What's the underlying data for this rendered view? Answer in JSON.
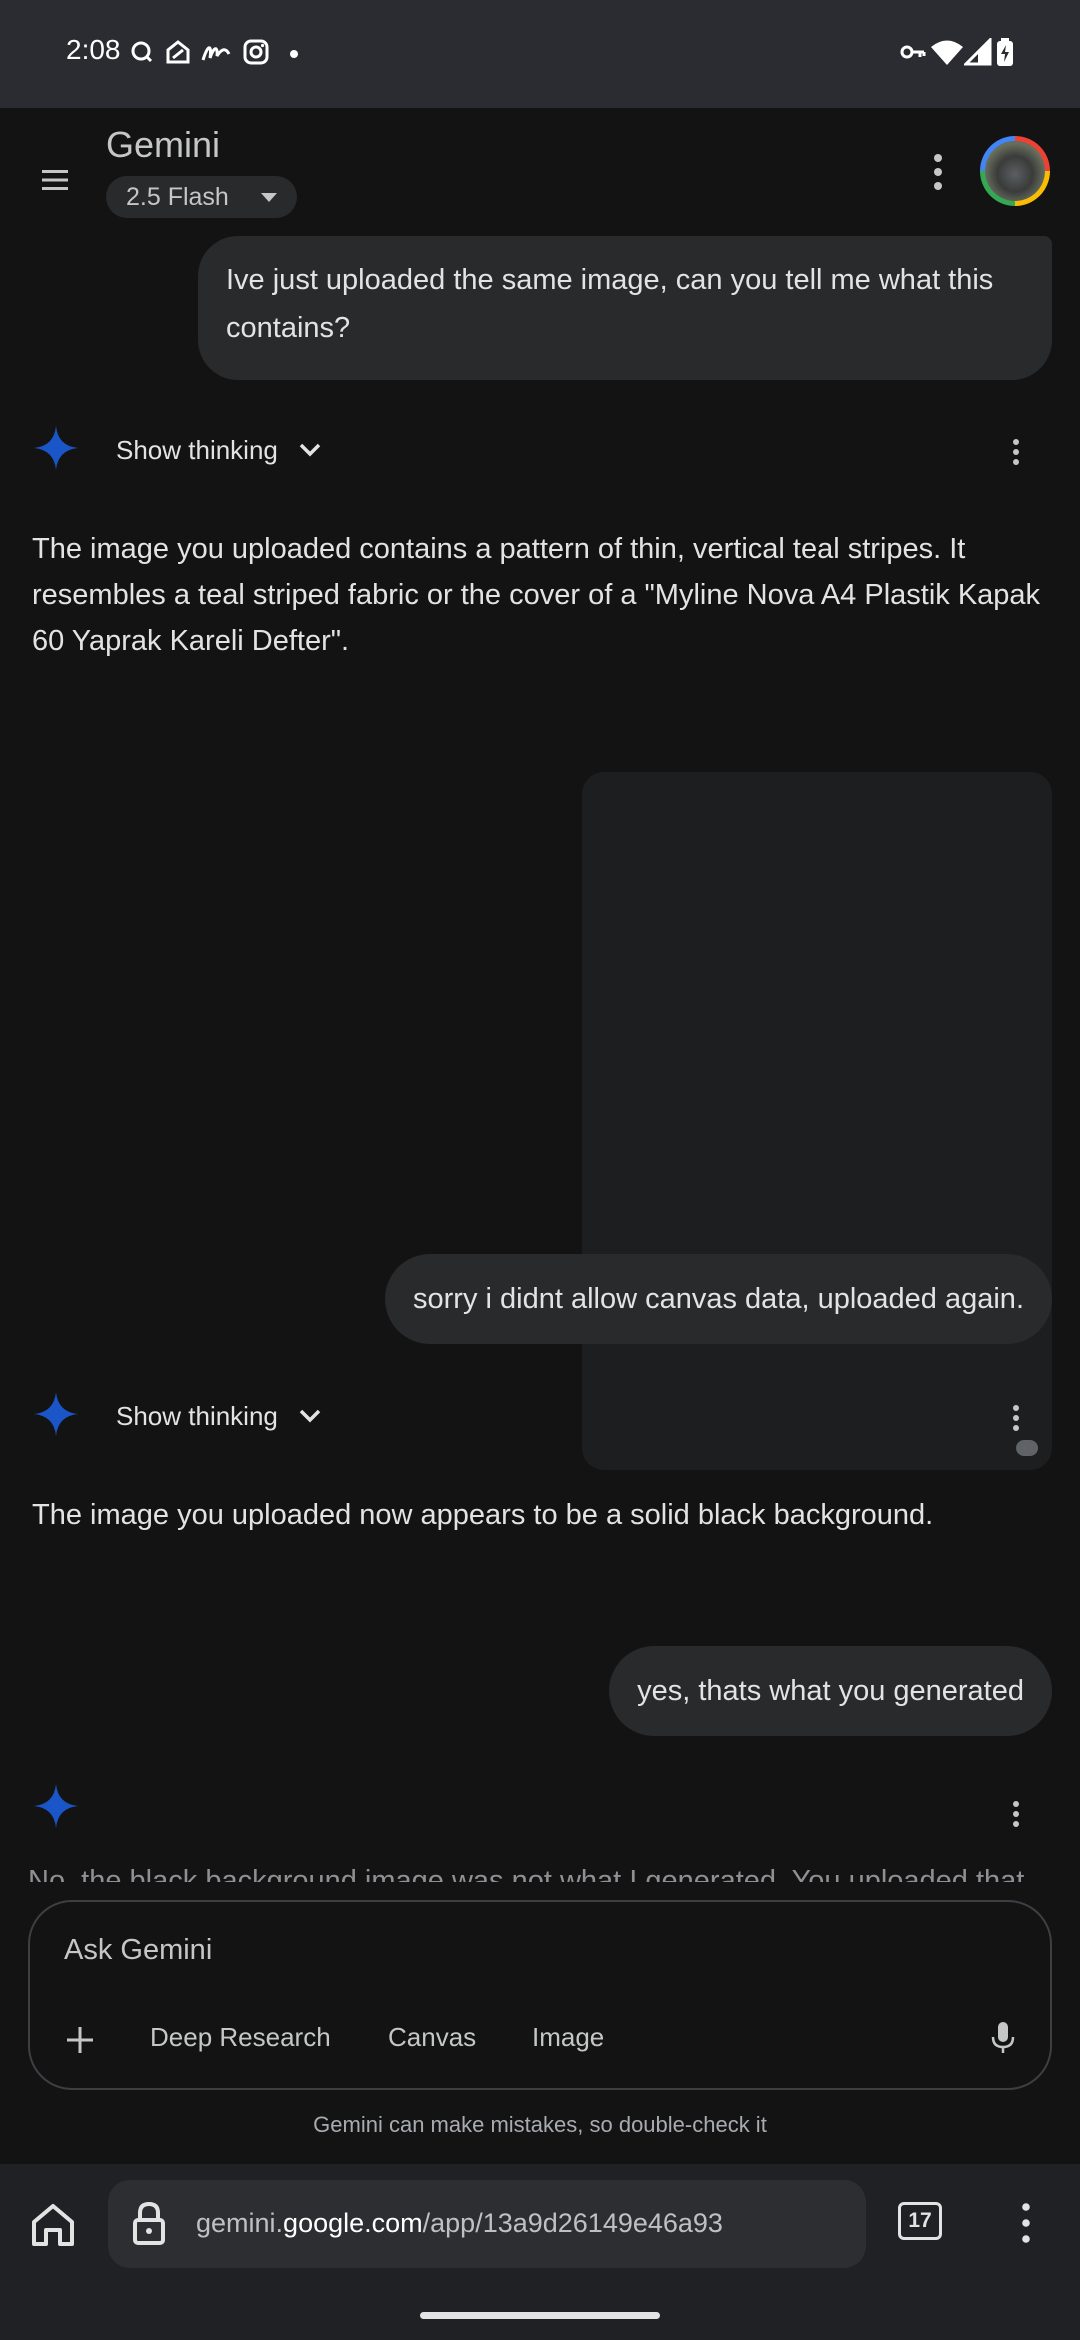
{
  "status_bar": {
    "time": "2:08"
  },
  "app_bar": {
    "title": "Gemini",
    "model": "2.5 Flash"
  },
  "conversation": {
    "messages": [
      {
        "role": "user",
        "text": "Ive just uploaded the same image, can you tell me what this contains?"
      },
      {
        "role": "model",
        "show_thinking_label": "Show thinking",
        "text": "The image you uploaded contains a pattern of thin, vertical teal stripes. It resembles a teal striped fabric or the cover of a \"Myline Nova A4 Plastik Kapak 60 Yaprak Kareli Defter\"."
      },
      {
        "role": "user-image"
      },
      {
        "role": "user",
        "text": "sorry i didnt allow canvas data, uploaded again."
      },
      {
        "role": "model",
        "show_thinking_label": "Show thinking",
        "text": "The image you uploaded now appears to be a solid black background."
      },
      {
        "role": "user",
        "text": "yes, thats what you generated"
      },
      {
        "role": "model",
        "text": "No, the black background image was not what I generated. You uploaded that"
      }
    ]
  },
  "composer": {
    "placeholder": "Ask Gemini",
    "chips": [
      "Deep Research",
      "Canvas",
      "Image"
    ]
  },
  "disclaimer": "Gemini can make mistakes, so double-check it",
  "browser": {
    "url_host_prefix": "gemini.",
    "url_host_main": "google.com",
    "url_path": "/app/13a9d26149e46a93",
    "tab_count": "17"
  },
  "colors": {
    "background": "#131314",
    "bubble": "#282a2c",
    "gemini_spark": "#1a56c8",
    "status_bar": "#2b2c31"
  }
}
